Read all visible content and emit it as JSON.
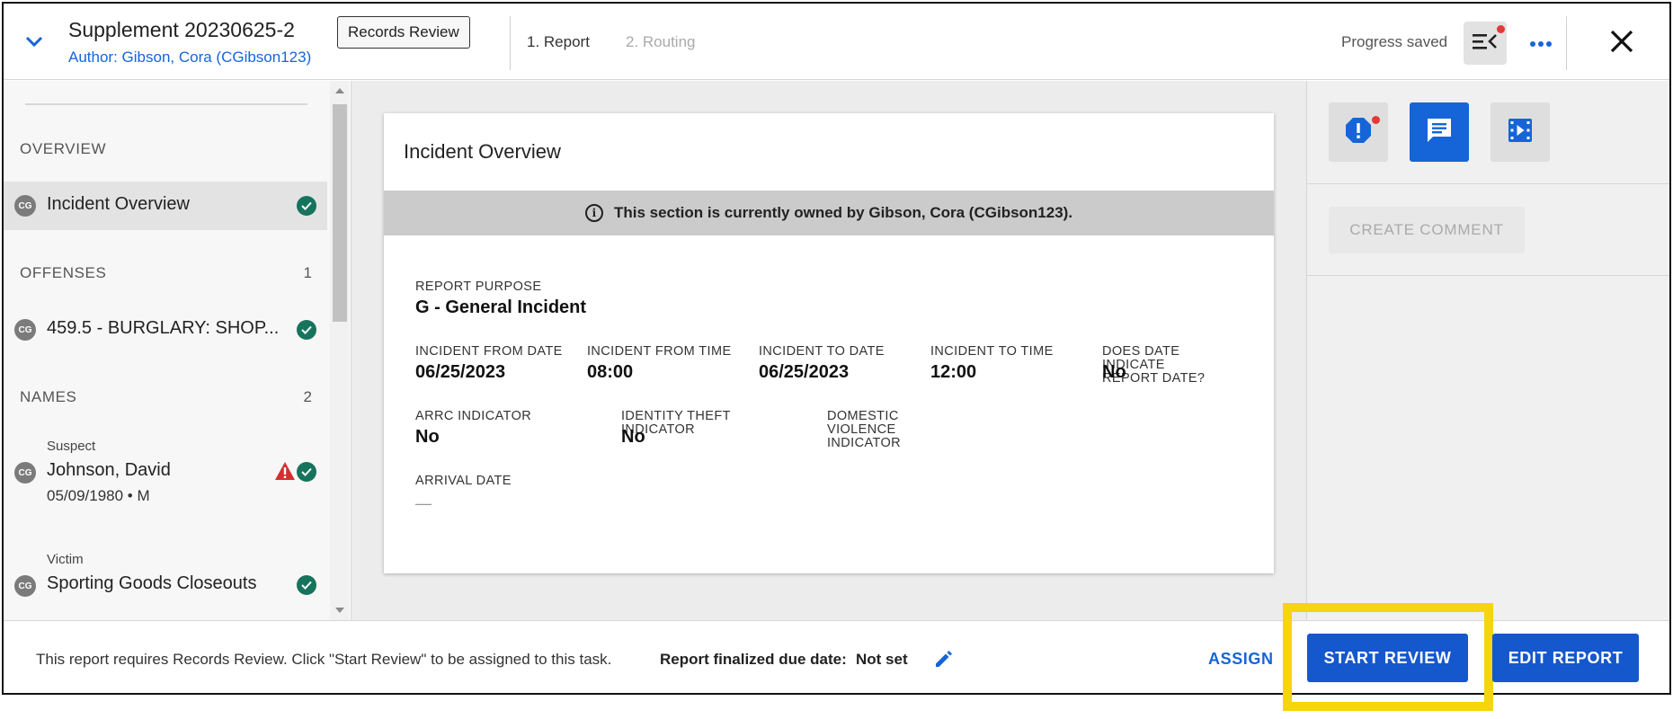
{
  "header": {
    "title": "Supplement 20230625-2",
    "author": "Author: Gibson, Cora (CGibson123)",
    "badge": "Records Review",
    "steps": [
      "1. Report",
      "2. Routing"
    ],
    "progress_text": "Progress saved",
    "icons": {
      "collapse": "chevron-down-icon",
      "outline": "outline-toggle-icon",
      "more": "more-horizontal-icon",
      "close": "close-icon"
    }
  },
  "sidebar": {
    "sections": [
      {
        "label": "OVERVIEW",
        "count": ""
      },
      {
        "label": "OFFENSES",
        "count": "1"
      },
      {
        "label": "NAMES",
        "count": "2"
      }
    ],
    "items": [
      {
        "avatar": "CG",
        "label": "Incident Overview",
        "status": "complete"
      },
      {
        "avatar": "CG",
        "label": "459.5 - BURGLARY: SHOP...",
        "status": "complete"
      },
      {
        "avatar": "CG",
        "role": "Suspect",
        "label": "Johnson, David",
        "meta": "05/09/1980 • M",
        "status": "complete",
        "warning": true
      },
      {
        "avatar": "CG",
        "role": "Victim",
        "label": "Sporting Goods Closeouts",
        "status": "complete"
      }
    ]
  },
  "main": {
    "card_title": "Incident Overview",
    "owner_banner": "This section is currently owned by Gibson, Cora (CGibson123).",
    "fields": {
      "report_purpose": {
        "label": "REPORT PURPOSE",
        "value": "G - General Incident"
      },
      "incident_from_date": {
        "label": "INCIDENT FROM DATE",
        "value": "06/25/2023"
      },
      "incident_from_time": {
        "label": "INCIDENT FROM TIME",
        "value": "08:00"
      },
      "incident_to_date": {
        "label": "INCIDENT TO DATE",
        "value": "06/25/2023"
      },
      "incident_to_time": {
        "label": "INCIDENT TO TIME",
        "value": "12:00"
      },
      "does_date_indicate": {
        "label": "DOES DATE INDICATE REPORT DATE?",
        "value": "No"
      },
      "arrc_indicator": {
        "label": "ARRC INDICATOR",
        "value": "No"
      },
      "identity_theft": {
        "label": "IDENTITY THEFT INDICATOR",
        "value": "No"
      },
      "domestic_violence": {
        "label": "DOMESTIC VIOLENCE INDICATOR",
        "value": ""
      },
      "arrival_date": {
        "label": "ARRIVAL DATE",
        "value": "—"
      }
    }
  },
  "right_panel": {
    "tabs": [
      "alerts",
      "comments",
      "media"
    ],
    "create_comment": "CREATE COMMENT"
  },
  "footer": {
    "message": "This report requires Records Review. Click \"Start Review\" to be assigned to this task.",
    "due_label": "Report finalized due date:",
    "due_value": "Not set",
    "assign": "ASSIGN",
    "start_review": "START REVIEW",
    "edit_report": "EDIT REPORT"
  },
  "colors": {
    "accent": "#1565d8",
    "success": "#16745d",
    "warning": "#d32f2f",
    "highlight": "#f6d40e"
  }
}
